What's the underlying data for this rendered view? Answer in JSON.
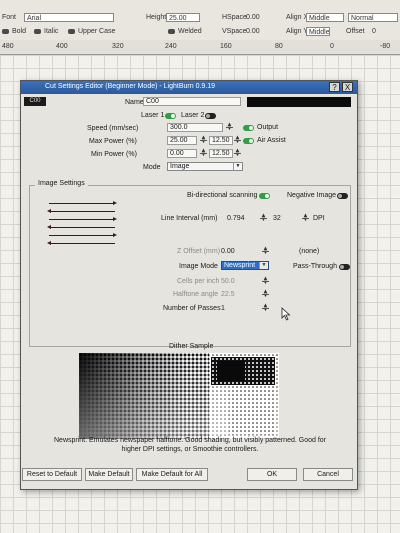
{
  "toolbar": {
    "font_label": "Font",
    "font_value": "Arial",
    "bold": "Bold",
    "italic": "Italic",
    "upper_case": "Upper Case",
    "welded": "Welded",
    "height_label": "Height",
    "height_value": "25.00",
    "hspace_label": "HSpace",
    "hspace_value": "0.00",
    "vspace_label": "VSpace",
    "vspace_value": "0.00",
    "align_x_label": "Align X",
    "align_x_value": "Middle",
    "align_y_label": "Align Y",
    "align_y_value": "Middle",
    "normal_value": "Normal",
    "offset_label": "Offset",
    "offset_value": "0"
  },
  "ruler": [
    "480",
    "400",
    "320",
    "240",
    "160",
    "80",
    "0",
    "-80"
  ],
  "dialog": {
    "title": "Cut Settings Editor (Beginner Mode) - LightBurn 0.9.19",
    "help_btn": "?",
    "close_btn": "X",
    "layer": "C00",
    "name_label": "Name",
    "name_value": "C00",
    "laser1": "Laser 1",
    "laser2": "Laser 2",
    "speed_label": "Speed (mm/sec)",
    "speed_value": "300.0",
    "output_label": "Output",
    "max_power_label": "Max Power (%)",
    "max_power_1": "25.00",
    "max_power_2": "12.50",
    "air_assist_label": "Air Assist",
    "min_power_label": "Min Power (%)",
    "min_power_1": "0.00",
    "min_power_2": "12.50",
    "mode_label": "Mode",
    "mode_value": "Image",
    "image_settings": {
      "title": "Image Settings",
      "bidirectional_label": "Bi-directional scanning",
      "negative_label": "Negative Image",
      "line_interval_label": "Line Interval (mm)",
      "line_interval_value": "0.794",
      "dpi_value": "32",
      "dpi_label": "DPI",
      "z_offset_label": "Z Offset (mm)",
      "z_offset_value": "0.00",
      "none_label": "(none)",
      "image_mode_label": "Image Mode",
      "image_mode_value": "Newsprint",
      "pass_through_label": "Pass-Through",
      "cells_label": "Cells per inch",
      "cells_value": "50.0",
      "halftone_label": "Halftone angle",
      "halftone_value": "22.5",
      "passes_label": "Number of Passes",
      "passes_value": "1"
    },
    "dither_title": "Dither Sample",
    "description": "Newsprint: Emulates newspaper halftone. Good shading, but visibly patterned. Good for higher DPI settings, or Smoothie controllers.",
    "buttons": {
      "reset": "Reset to Default",
      "make_default": "Make Default",
      "make_default_all": "Make Default for All",
      "ok": "OK",
      "cancel": "Cancel"
    }
  }
}
